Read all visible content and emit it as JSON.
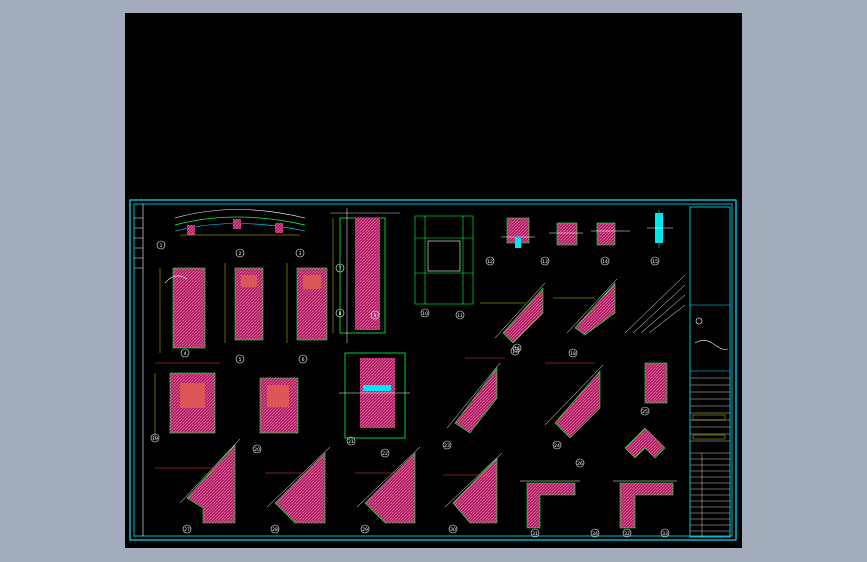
{
  "viewer": {
    "background_color": "#a3acbd",
    "canvas_color": "#000000"
  },
  "sheet": {
    "frame_color": "#00e5ff",
    "line_green": "#00ff3c",
    "line_white": "#ffffff",
    "line_yellow": "#ffff00",
    "line_red": "#ff3b3b",
    "hatch_magenta": "#ff4fa0",
    "detail_markers": [
      "1",
      "2",
      "3",
      "4",
      "5",
      "6",
      "7",
      "8",
      "9",
      "10",
      "11",
      "12",
      "13",
      "14",
      "15",
      "16",
      "17",
      "18",
      "19",
      "20",
      "21",
      "22",
      "23",
      "24",
      "25",
      "26",
      "27",
      "28",
      "29",
      "30",
      "31",
      "32",
      "33",
      "34"
    ]
  }
}
